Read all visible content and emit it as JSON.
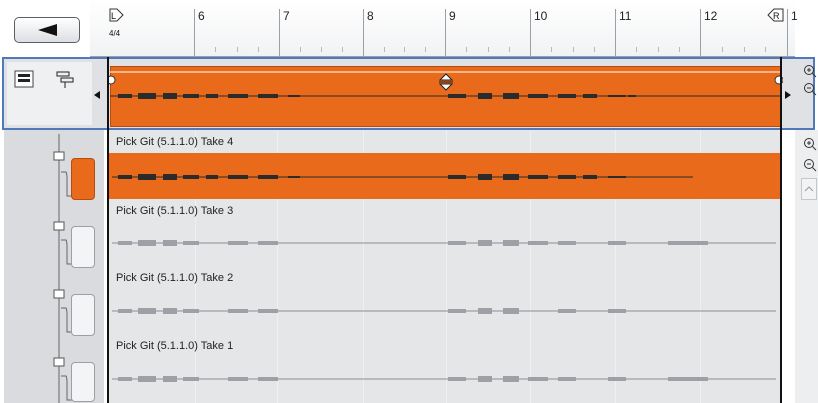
{
  "toolbar": {
    "back_icon": "left-triangle-icon"
  },
  "ruler": {
    "left_locator": "L",
    "right_locator": "R",
    "time_signature": "4/4",
    "bars": [
      "6",
      "7",
      "8",
      "9",
      "10",
      "11",
      "12",
      "1"
    ]
  },
  "comp_lane": {
    "tools": [
      "lanes-view-icon",
      "comp-view-icon"
    ]
  },
  "takes": [
    {
      "label": "Pick Git (5.1.1.0) Take 4",
      "active": true
    },
    {
      "label": "Pick Git (5.1.1.0) Take 3",
      "active": false
    },
    {
      "label": "Pick Git (5.1.1.0) Take 2",
      "active": false
    },
    {
      "label": "Pick Git (5.1.1.0) Take 1",
      "active": false
    }
  ],
  "colors": {
    "accent": "#e86a1a",
    "selection_border": "#4f79b8",
    "lane_background": "#e4e6e8"
  }
}
